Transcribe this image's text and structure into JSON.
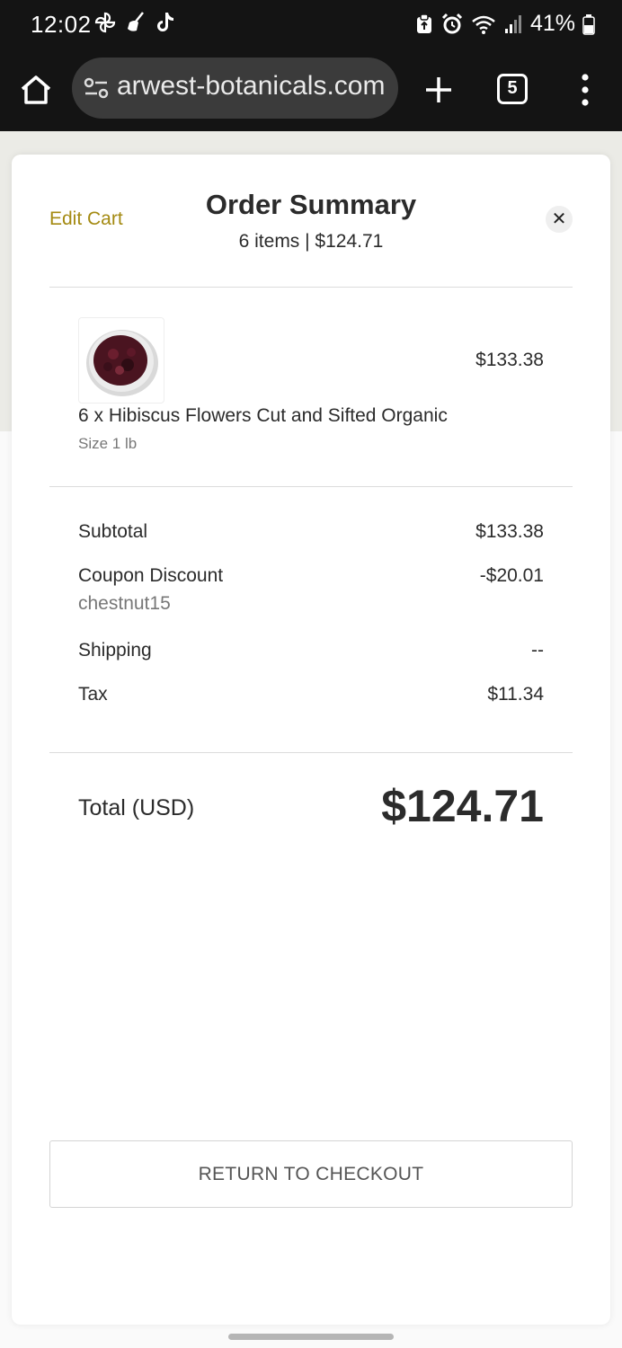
{
  "status_bar": {
    "time": "12:02",
    "battery_percent": "41%",
    "left_icons": [
      "pinwheel-icon",
      "broom-icon",
      "tiktok-icon"
    ],
    "right_icons": [
      "clipboard-icon",
      "alarm-icon",
      "wifi-icon",
      "signal-icon",
      "battery-icon"
    ]
  },
  "browser": {
    "url": "arwest-botanicals.com",
    "tab_count": "5"
  },
  "modal": {
    "edit_cart_label": "Edit Cart",
    "title": "Order Summary",
    "subtitle": "6 items | $124.71",
    "item": {
      "name": "6 x Hibiscus Flowers Cut and Sifted Organic",
      "size": "Size 1 lb",
      "price": "$133.38"
    },
    "summary": {
      "subtotal_label": "Subtotal",
      "subtotal_value": "$133.38",
      "coupon_label": "Coupon Discount",
      "coupon_value": "-$20.01",
      "coupon_code": "chestnut15",
      "shipping_label": "Shipping",
      "shipping_value": "--",
      "tax_label": "Tax",
      "tax_value": "$11.34"
    },
    "total_label": "Total (USD)",
    "total_value": "$124.71",
    "return_button": "RETURN TO CHECKOUT"
  },
  "colors": {
    "accent": "#a48a12",
    "text": "#2b2b2b",
    "chrome": "#141414"
  }
}
